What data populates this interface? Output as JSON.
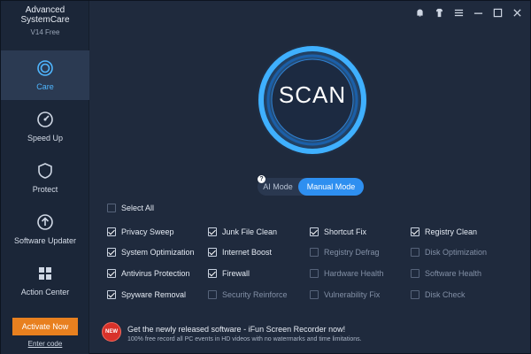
{
  "app": {
    "title": "Advanced SystemCare",
    "version": "V14 Free"
  },
  "sidebar": {
    "items": [
      {
        "label": "Care",
        "icon": "care-icon",
        "active": true
      },
      {
        "label": "Speed Up",
        "icon": "speedometer-icon",
        "active": false
      },
      {
        "label": "Protect",
        "icon": "shield-icon",
        "active": false
      },
      {
        "label": "Software Updater",
        "icon": "update-arrow-icon",
        "active": false
      },
      {
        "label": "Action Center",
        "icon": "grid-icon",
        "active": false
      }
    ],
    "activate_label": "Activate Now",
    "enter_code_label": "Enter code"
  },
  "window_controls": [
    "bell-icon",
    "shirt-skin-icon",
    "menu-icon",
    "minimize-icon",
    "maximize-icon",
    "close-icon"
  ],
  "scan": {
    "label": "SCAN"
  },
  "mode": {
    "help": "?",
    "ai_label": "AI Mode",
    "manual_label": "Manual Mode",
    "selected": "Manual Mode"
  },
  "select_all": {
    "label": "Select All",
    "checked": false
  },
  "options": [
    {
      "label": "Privacy Sweep",
      "checked": true
    },
    {
      "label": "Junk File Clean",
      "checked": true
    },
    {
      "label": "Shortcut Fix",
      "checked": true
    },
    {
      "label": "Registry Clean",
      "checked": true
    },
    {
      "label": "System Optimization",
      "checked": true
    },
    {
      "label": "Internet Boost",
      "checked": true
    },
    {
      "label": "Registry Defrag",
      "checked": false
    },
    {
      "label": "Disk Optimization",
      "checked": false
    },
    {
      "label": "Antivirus Protection",
      "checked": true
    },
    {
      "label": "Firewall",
      "checked": true
    },
    {
      "label": "Hardware Health",
      "checked": false
    },
    {
      "label": "Software Health",
      "checked": false
    },
    {
      "label": "Spyware Removal",
      "checked": true
    },
    {
      "label": "Security Reinforce",
      "checked": false
    },
    {
      "label": "Vulnerability Fix",
      "checked": false
    },
    {
      "label": "Disk Check",
      "checked": false
    }
  ],
  "promo": {
    "badge": "NEW",
    "title": "Get the newly released software - iFun Screen Recorder now!",
    "subtitle": "100% free record all PC events in HD videos with no watermarks and time limitations."
  },
  "colors": {
    "accent": "#2e8ff0",
    "activate": "#e8801f",
    "background": "#1f2a3d"
  }
}
